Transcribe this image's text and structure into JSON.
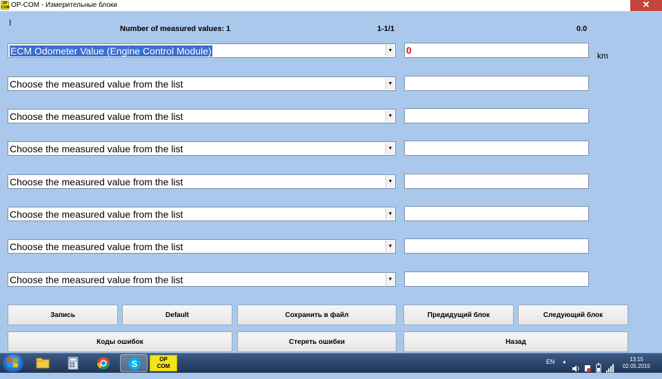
{
  "window": {
    "title": "OP-COM - Измерительные блоки",
    "icon_text": "OP COM",
    "close_glyph": "✕"
  },
  "header": {
    "cursor_glyph": "I",
    "count_label": "Number of measured values: 1",
    "range": "1-1/1",
    "reading": "0.0"
  },
  "rows": [
    {
      "label": "ECM Odometer Value (Engine Control Module)",
      "selected": true,
      "value": "0",
      "unit": "km"
    },
    {
      "label": "Choose the measured value from the list",
      "value": ""
    },
    {
      "label": "Choose the measured value from the list",
      "value": ""
    },
    {
      "label": "Choose the measured value from the list",
      "value": ""
    },
    {
      "label": "Choose the measured value from the list",
      "value": ""
    },
    {
      "label": "Choose the measured value from the list",
      "value": ""
    },
    {
      "label": "Choose the measured value from the list",
      "value": ""
    },
    {
      "label": "Choose the measured value from the list",
      "value": ""
    }
  ],
  "buttons": {
    "record": "Запись",
    "default": "Default",
    "save_file": "Сохранить в файл",
    "prev_block": "Предидущий блок",
    "next_block": "Следующий блок",
    "error_codes": "Коды ошибок",
    "clear_errors": "Стереть ошибки",
    "back": "Назад"
  },
  "taskbar": {
    "opcom_label_1": "OP",
    "opcom_label_2": "COM",
    "lang": "EN",
    "time": "13:15",
    "date": "02.05.2015"
  },
  "colors": {
    "background": "#a9c8ec",
    "value_red": "#e01010",
    "selection": "#3a6fd0"
  }
}
